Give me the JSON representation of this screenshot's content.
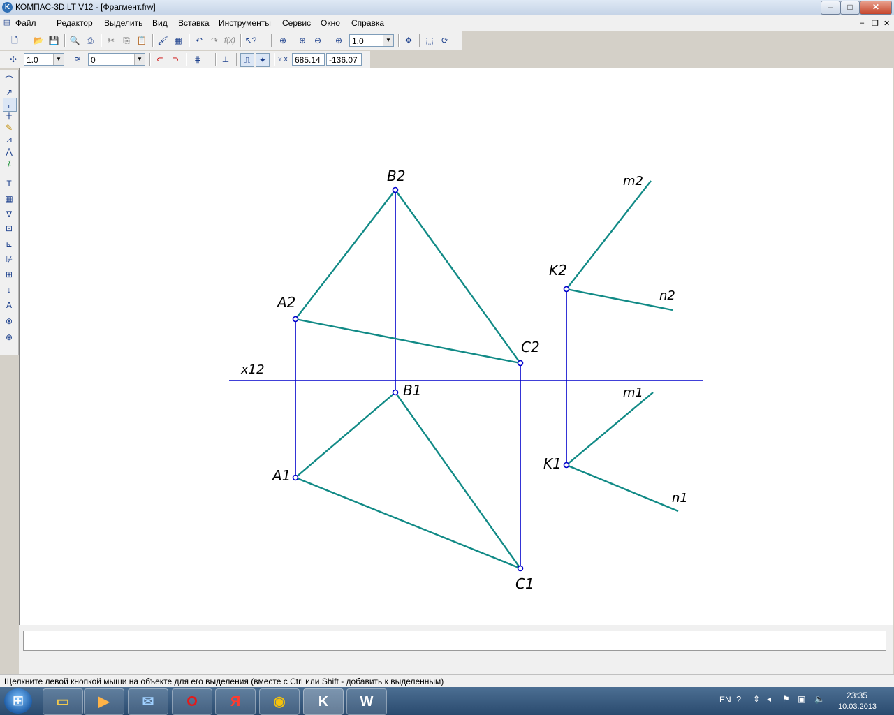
{
  "window": {
    "title": "КОМПАС-3D LT V12 - [Фрагмент.frw]",
    "app_icon_letter": "K",
    "minimize": "–",
    "maximize": "□",
    "close": "✕"
  },
  "menu": {
    "items": [
      "Файл",
      "Редактор",
      "Выделить",
      "Вид",
      "Вставка",
      "Инструменты",
      "Сервис",
      "Окно",
      "Справка"
    ],
    "mdi_minimize": "–",
    "mdi_restore": "❐",
    "mdi_close": "✕"
  },
  "toolbar1": {
    "zoom_value": "1.0"
  },
  "toolbar2": {
    "step_value": "1.0",
    "layer_value": "0",
    "coord_x": "685.14",
    "coord_y": "-136.07",
    "coord_label": "Y X"
  },
  "drawing": {
    "labels": {
      "B2": "B2",
      "A2": "A2",
      "C2": "C2",
      "x12": "x12",
      "B1": "B1",
      "A1": "A1",
      "C1": "C1",
      "K2": "K2",
      "m2": "m2",
      "n2": "n2",
      "m1": "m1",
      "K1": "K1",
      "n1": "n1"
    },
    "colors": {
      "projection": "#0000cc",
      "geometry": "#118a86",
      "point": "#0000cc"
    }
  },
  "status": {
    "hint": "Щелкните левой кнопкой мыши на объекте для его выделения (вместе с Ctrl или Shift - добавить к выделенным)"
  },
  "taskbar": {
    "start_glyph": "⊞",
    "tasks": [
      "explorer",
      "media-player",
      "mail",
      "O",
      "Я",
      "chrome",
      "K",
      "W"
    ],
    "language": "EN",
    "time": "23:35",
    "date": "10.03.2013"
  }
}
